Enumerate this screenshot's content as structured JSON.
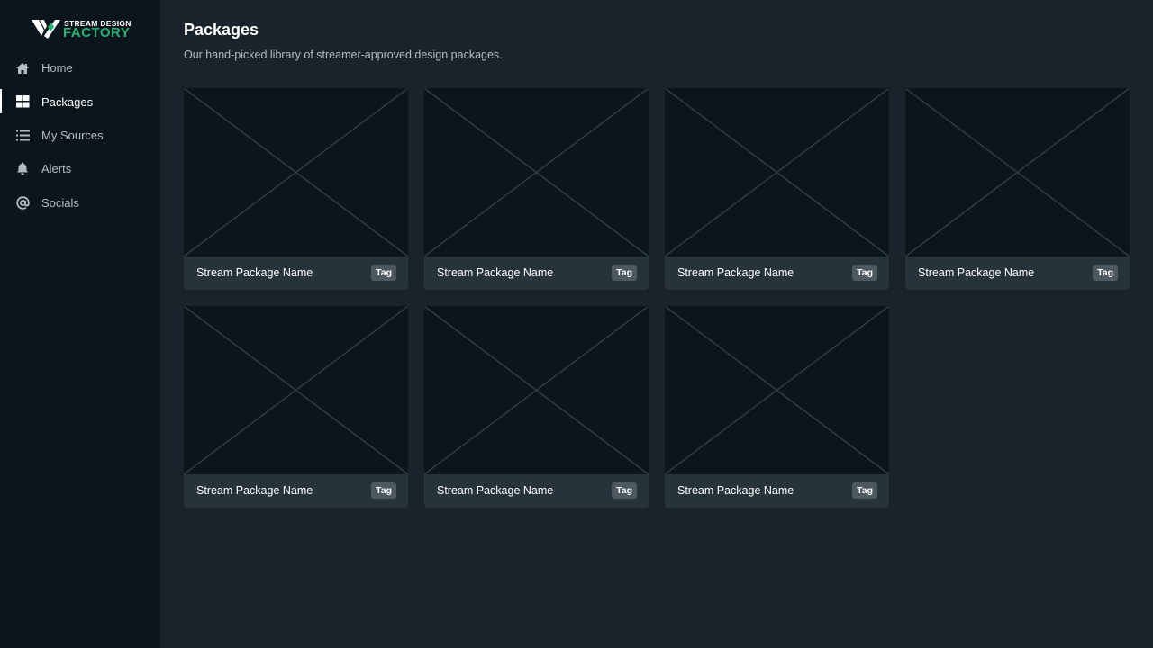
{
  "brand": {
    "line1": "STREAM DESIGN",
    "line2": "FACTORY",
    "accent_color": "#22b573"
  },
  "sidebar": {
    "items": [
      {
        "label": "Home",
        "icon": "home-icon",
        "active": false
      },
      {
        "label": "Packages",
        "icon": "grid-icon",
        "active": true
      },
      {
        "label": "My Sources",
        "icon": "list-icon",
        "active": false
      },
      {
        "label": "Alerts",
        "icon": "bell-icon",
        "active": false
      },
      {
        "label": "Socials",
        "icon": "at-icon",
        "active": false
      }
    ]
  },
  "main": {
    "title": "Packages",
    "subtitle": "Our hand-picked library of streamer-approved design packages."
  },
  "packages": [
    {
      "name": "Stream Package Name",
      "tag": "Tag"
    },
    {
      "name": "Stream Package Name",
      "tag": "Tag"
    },
    {
      "name": "Stream Package Name",
      "tag": "Tag"
    },
    {
      "name": "Stream Package Name",
      "tag": "Tag"
    },
    {
      "name": "Stream Package Name",
      "tag": "Tag"
    },
    {
      "name": "Stream Package Name",
      "tag": "Tag"
    },
    {
      "name": "Stream Package Name",
      "tag": "Tag"
    }
  ],
  "colors": {
    "background": "#1a232b",
    "sidebar": "#0c151b",
    "card_footer": "#27333b",
    "tag": "#4c5960",
    "placeholder_lines": "#2e3c44"
  }
}
